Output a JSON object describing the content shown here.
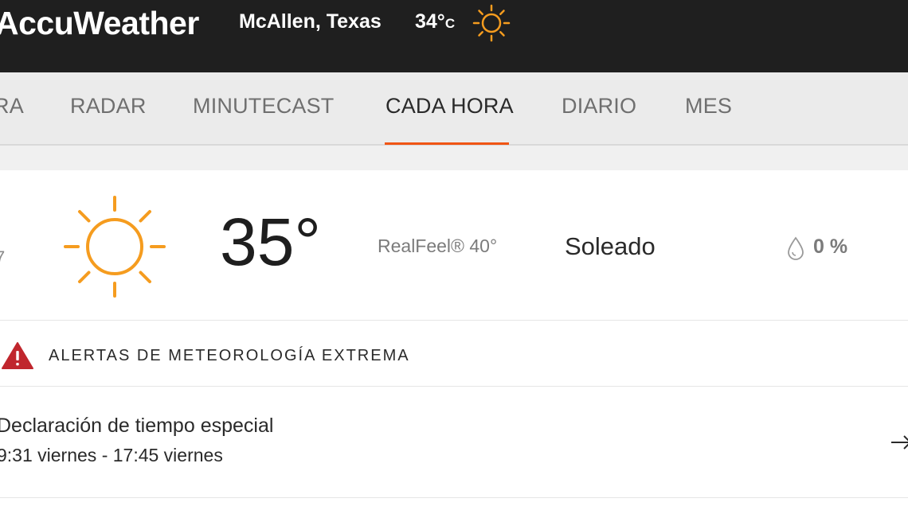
{
  "header": {
    "brand": "AccuWeather",
    "location": "McAllen, Texas",
    "temperature": "34°",
    "unit": "C",
    "icon": "sun-icon"
  },
  "nav": {
    "items": [
      {
        "label": "RA",
        "active": false
      },
      {
        "label": "RADAR",
        "active": false
      },
      {
        "label": "MINUTECAST",
        "active": false
      },
      {
        "label": "CADA HORA",
        "active": true
      },
      {
        "label": "DIARIO",
        "active": false
      },
      {
        "label": "MES",
        "active": false
      }
    ],
    "accent": "#f05514"
  },
  "hourly": {
    "hour_fragment": "7",
    "icon": "sun-icon",
    "temperature": "35°",
    "realfeel": "RealFeel® 40°",
    "phrase": "Soleado",
    "precip_icon": "drop-icon",
    "precip": "0 %"
  },
  "alerts": {
    "icon": "warning-triangle-icon",
    "title": "ALERTAS DE METEOROLOGÍA EXTREMA",
    "items": [
      {
        "title": "Declaración de tiempo especial",
        "time": "9:31 viernes - 17:45 viernes",
        "icon": "arrow-right-icon"
      }
    ]
  },
  "colors": {
    "topbar": "#1f1f1f",
    "sun": "#f59c1f",
    "alert": "#c0262d",
    "accent": "#f05514"
  }
}
